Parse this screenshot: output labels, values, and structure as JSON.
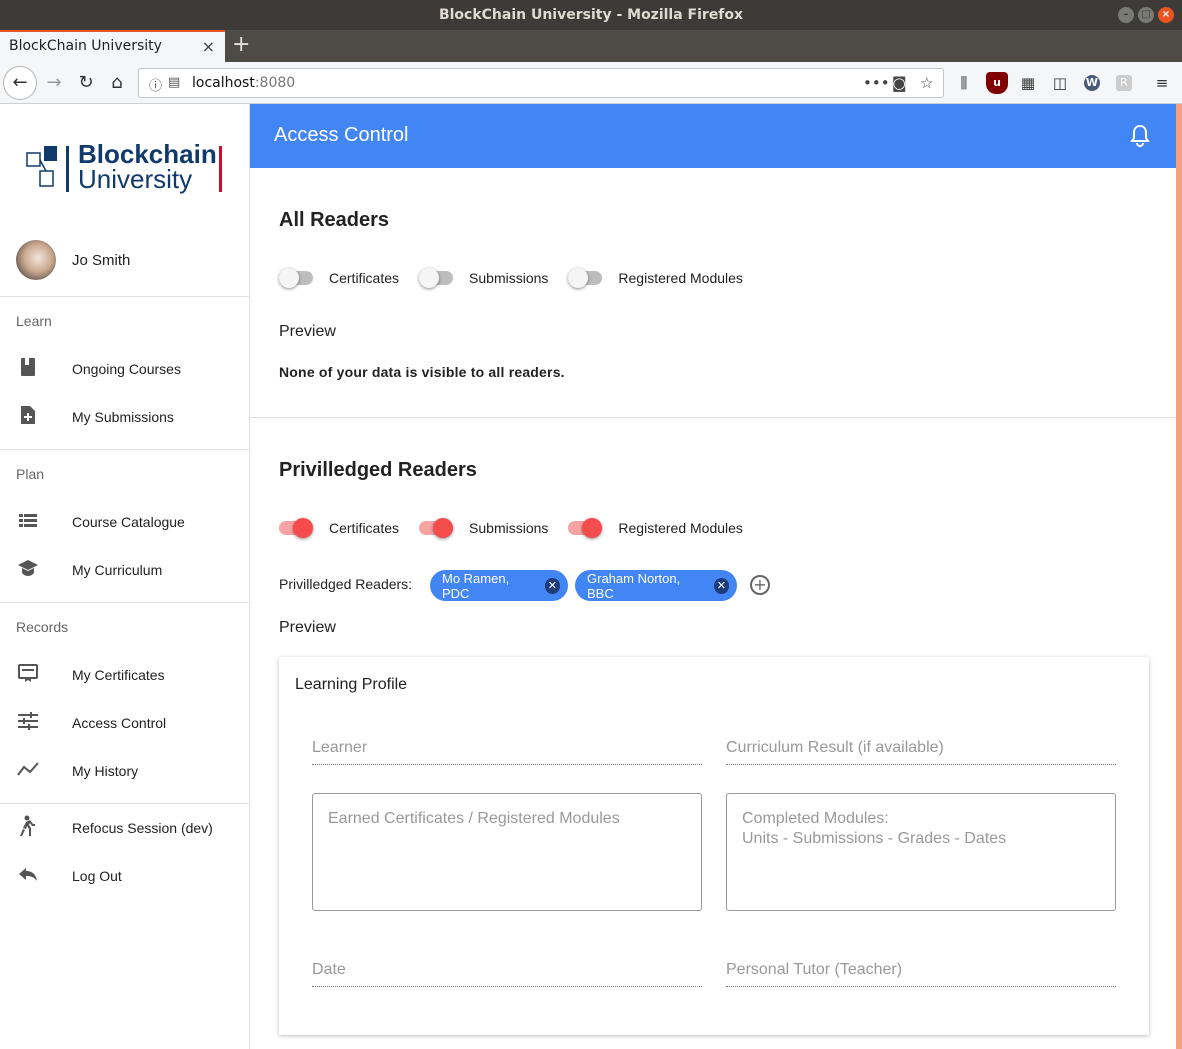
{
  "window": {
    "title": "BlockChain University - Mozilla Firefox"
  },
  "browser": {
    "tab_title": "BlockChain University",
    "url_host": "localhost",
    "url_port": ":8080",
    "ublock_count": "11"
  },
  "sidebar": {
    "logo_line1": "Blockchain",
    "logo_line2": "University",
    "user_name": "Jo Smith",
    "sections": [
      {
        "title": "Learn",
        "items": [
          {
            "label": "Ongoing Courses",
            "icon": "book-icon"
          },
          {
            "label": "My Submissions",
            "icon": "add-file-icon"
          }
        ]
      },
      {
        "title": "Plan",
        "items": [
          {
            "label": "Course Catalogue",
            "icon": "list-icon"
          },
          {
            "label": "My Curriculum",
            "icon": "school-icon"
          }
        ]
      },
      {
        "title": "Records",
        "items": [
          {
            "label": "My Certificates",
            "icon": "certificate-icon"
          },
          {
            "label": "Access Control",
            "icon": "tune-icon"
          },
          {
            "label": "My History",
            "icon": "timeline-icon"
          }
        ]
      }
    ],
    "footer_items": [
      {
        "label": "Refocus Session (dev)",
        "icon": "walk-icon"
      },
      {
        "label": "Log Out",
        "icon": "reply-icon"
      }
    ]
  },
  "header": {
    "title": "Access Control"
  },
  "all_readers": {
    "title": "All Readers",
    "toggles": [
      {
        "label": "Certificates",
        "on": false
      },
      {
        "label": "Submissions",
        "on": false
      },
      {
        "label": "Registered Modules",
        "on": false
      }
    ],
    "preview_label": "Preview",
    "preview_note": "None of your data is visible to all readers."
  },
  "privileged_readers": {
    "title": "Privilledged Readers",
    "toggles": [
      {
        "label": "Certificates",
        "on": true
      },
      {
        "label": "Submissions",
        "on": true
      },
      {
        "label": "Registered Modules",
        "on": true
      }
    ],
    "readers_label": "Privilledged Readers:",
    "readers": [
      "Mo Ramen, PDC",
      "Graham Norton, BBC"
    ],
    "preview_label": "Preview"
  },
  "learning_profile": {
    "title": "Learning Profile",
    "learner_label": "Learner",
    "curriculum_label": "Curriculum Result (if available)",
    "certificates_label": "Earned Certificates / Registered Modules",
    "completed_label_1": "Completed Modules:",
    "completed_label_2": "Units - Submissions - Grades - Dates",
    "date_label": "Date",
    "tutor_label": "Personal Tutor (Teacher)"
  },
  "colors": {
    "appbar": "#4285f4",
    "toggle_on": "#f44c4c",
    "chip": "#4285f4",
    "window_accent": "#e95420"
  }
}
